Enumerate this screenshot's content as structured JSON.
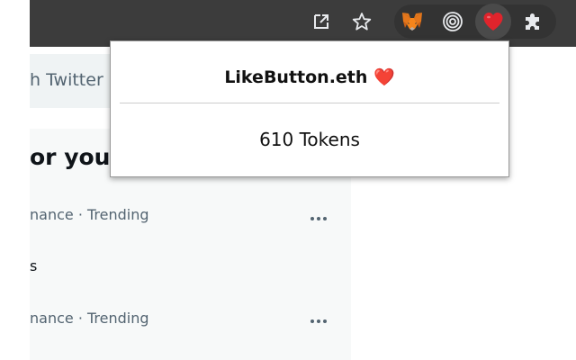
{
  "browser": {
    "toolbar_icons": [
      "open-external-icon",
      "star-bookmark-icon"
    ],
    "extensions": [
      "metamask-fox-icon",
      "target-rings-icon",
      "heart-icon",
      "puzzle-extensions-icon"
    ],
    "colors": {
      "toolbar": "#3c3c3c",
      "icon": "#e8eaed",
      "heart": "#e0242c"
    }
  },
  "page": {
    "search_text": "h Twitter",
    "trends_title": "or you",
    "trends": [
      {
        "meta": "nance · Trending",
        "name": "s"
      },
      {
        "meta": "nance · Trending",
        "name": ""
      }
    ]
  },
  "popup": {
    "title": "LikeButton.eth ❤️",
    "tokens": "610 Tokens"
  }
}
